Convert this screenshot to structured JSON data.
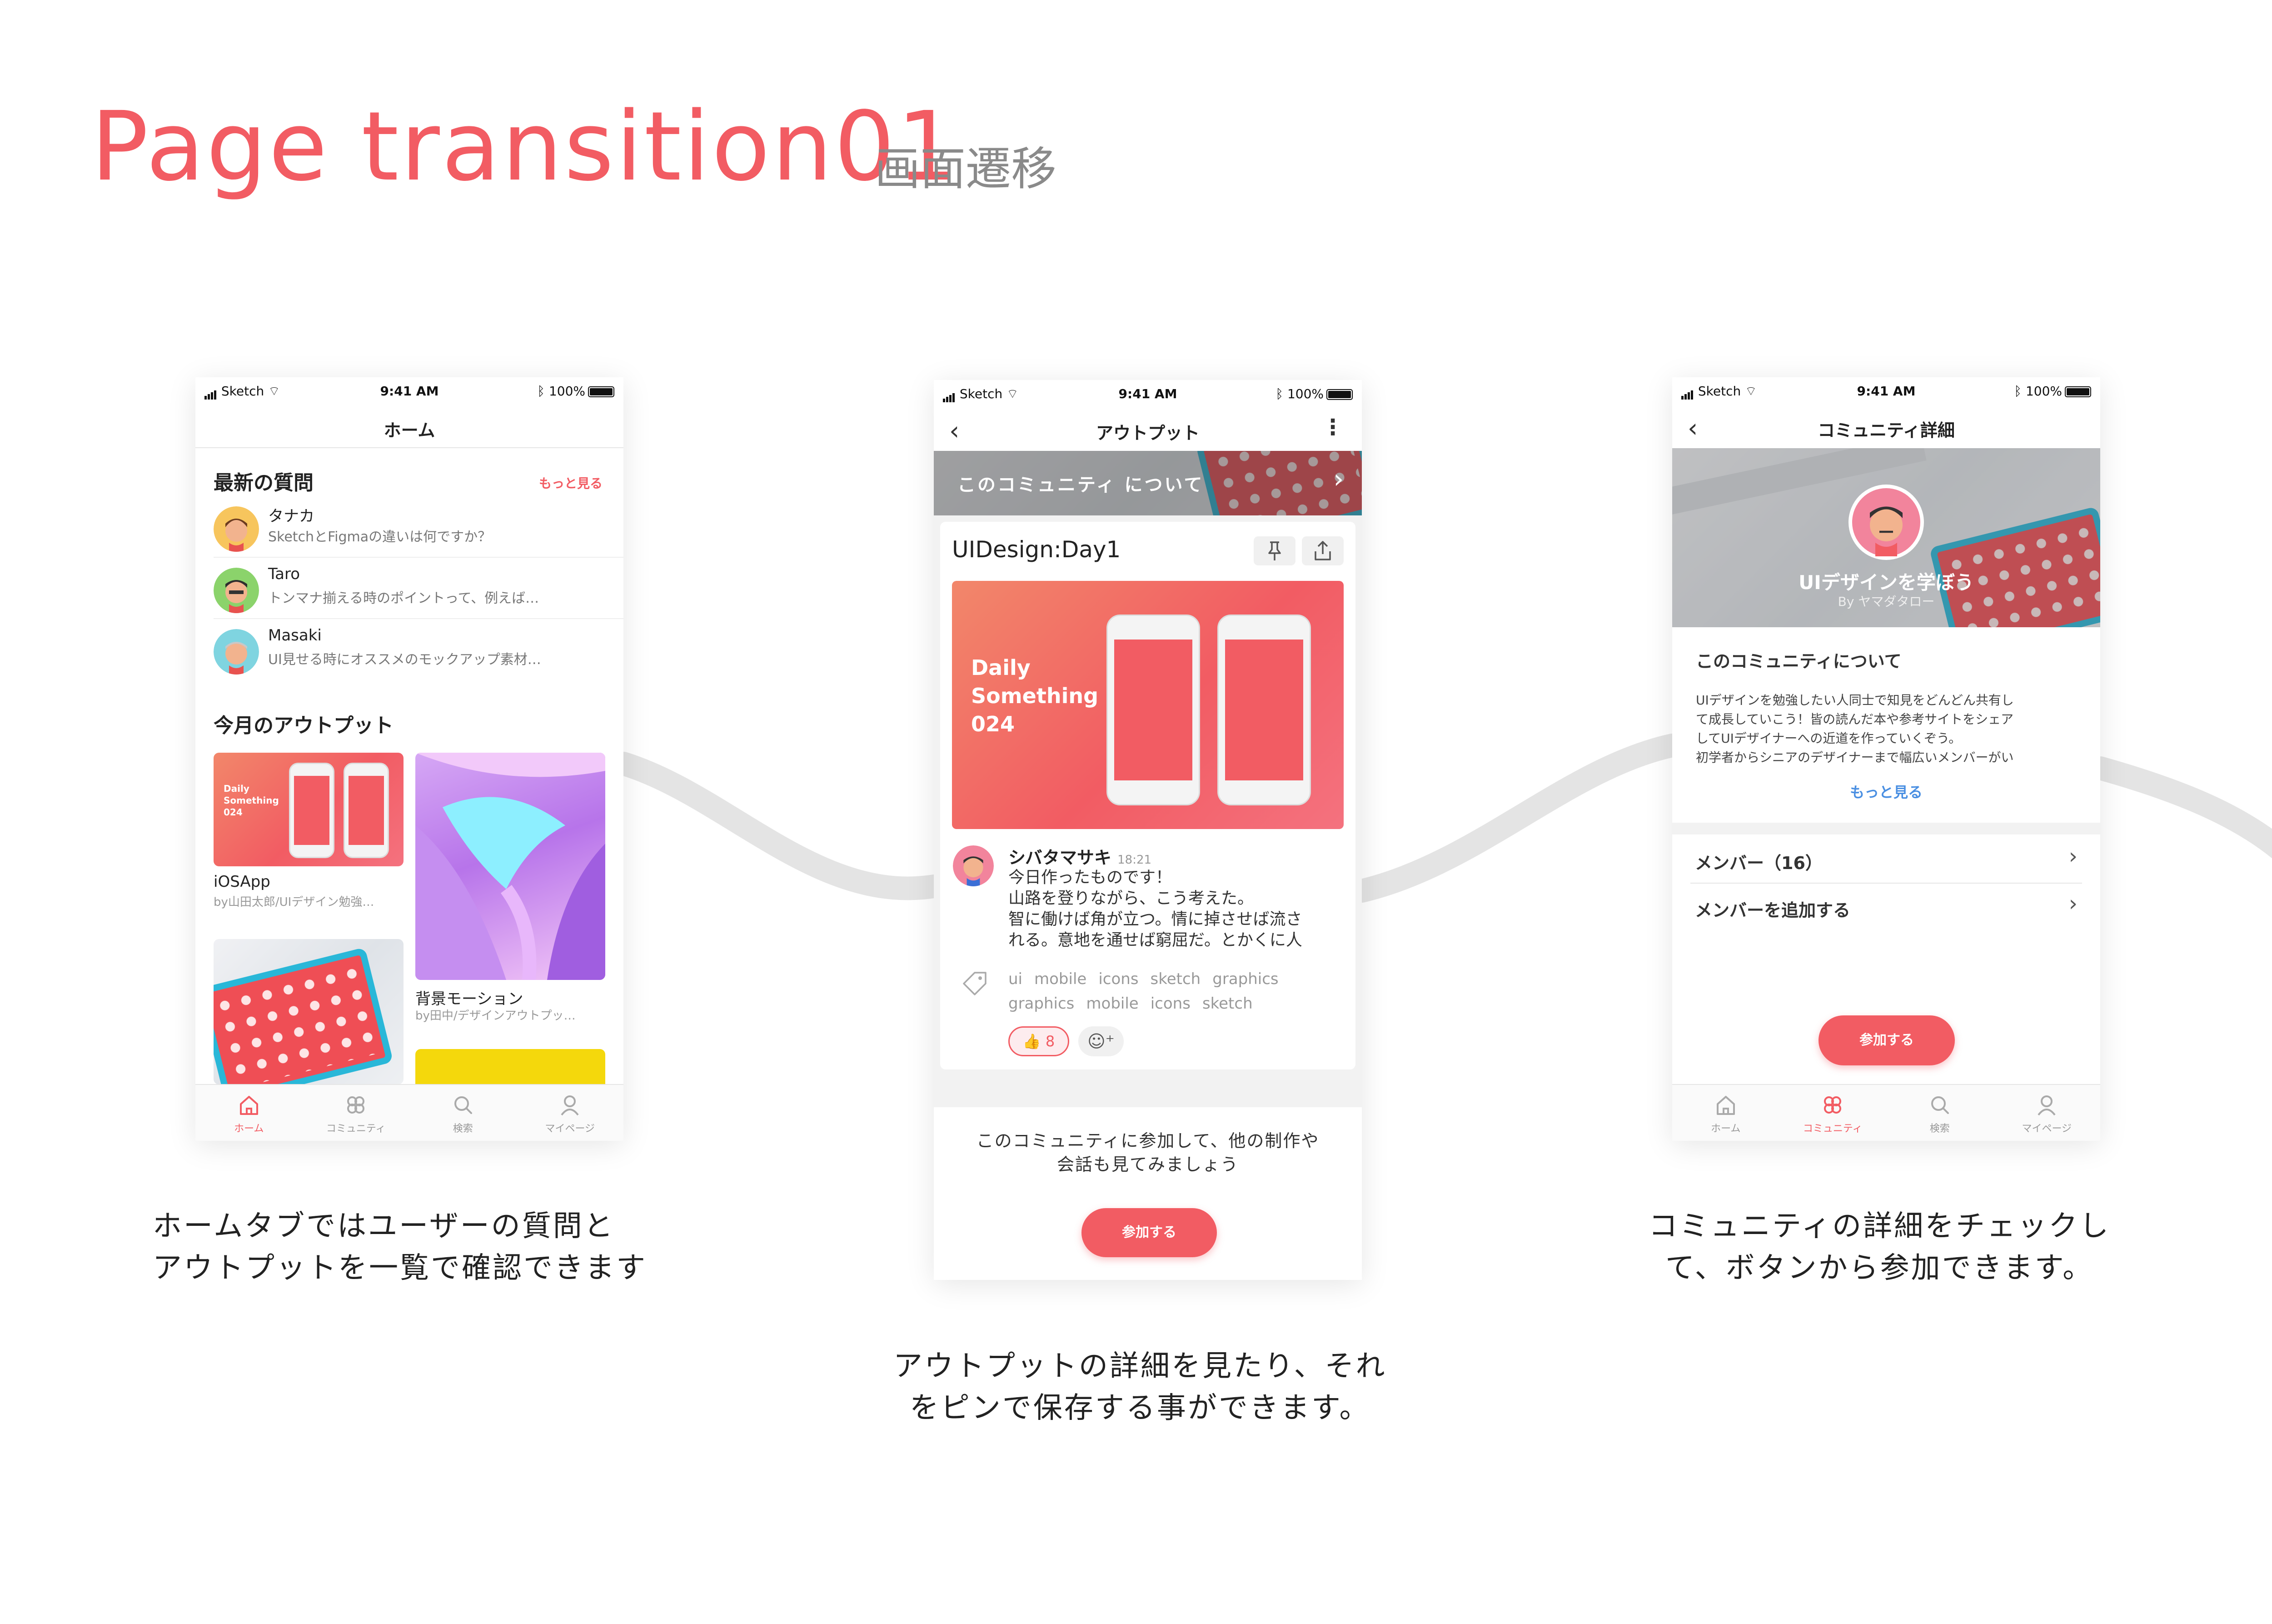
{
  "header": {
    "title": "Page transition01",
    "subtitle": "画面遷移"
  },
  "status_bar": {
    "carrier": "Sketch",
    "time": "9:41 AM",
    "battery": "100%"
  },
  "screen_home": {
    "nav_title": "ホーム",
    "questions_title": "最新の質問",
    "questions_more": "もっと見る",
    "questions": [
      {
        "name": "タナカ",
        "text": "SketchとFigmaの違いは何ですか？"
      },
      {
        "name": "Taro",
        "text": "トンマナ揃える時のポイントって、例えば…"
      },
      {
        "name": "Masaki",
        "text": "UI見せる時にオススメのモックアップ素材…"
      }
    ],
    "outputs_title": "今月のアウトプット",
    "outputs": [
      {
        "title": "iOSApp",
        "sub": "by山田太郎/UIデザイン勉強…",
        "card_text": "Daily Something 024"
      },
      {
        "title": "背景モーション",
        "sub": "by田中/デザインアウトプッ…"
      }
    ],
    "tabs": [
      "ホーム",
      "コミュニティ",
      "検索",
      "マイページ"
    ]
  },
  "screen_output": {
    "nav_title": "アウトプット",
    "banner": "このコミュニティ について",
    "post_title": "UIDesign:Day1",
    "hero_text": "Daily Something 024",
    "author": "シバタマサキ",
    "time": "18:21",
    "body": [
      "今日作ったものです！",
      "山路を登りながら、こう考えた。",
      "智に働けば角が立つ。情に掉させば流さ",
      "れる。意地を通せば窮屈だ。とかくに人"
    ],
    "tags_line1": [
      "ui",
      "mobile",
      "icons",
      "sketch",
      "graphics"
    ],
    "tags_line2": [
      "graphics",
      "mobile",
      "icons",
      "sketch"
    ],
    "like_count": "8",
    "join_text_line1": "このコミュニティに参加して、他の制作や",
    "join_text_line2": "会話も見てみましょう",
    "join_button": "参加する"
  },
  "screen_community": {
    "nav_title": "コミュニティ詳細",
    "community_name": "UIデザインを学ぼう",
    "community_by": "By ヤマダタロー",
    "about_title": "このコミュニティについて",
    "about_lines": [
      "UIデザインを勉強したい人同士で知見をどんどん共有し",
      "て成長していこう！皆の読んだ本や参考サイトをシェア",
      "してUIデザイナーへの近道を作っていくぞう。",
      "初学者からシニアのデザイナーまで幅広いメンバーがい"
    ],
    "about_more": "もっと見る",
    "members": "メンバー（16）",
    "add_member": "メンバーを追加する",
    "join_button": "参加する",
    "tabs": [
      "ホーム",
      "コミュニティ",
      "検索",
      "マイページ"
    ]
  },
  "captions": {
    "home_line1": "ホームタブではユーザーの質問と",
    "home_line2": "アウトプットを一覧で確認できます",
    "output_line1": "アウトプットの詳細を見たり、それ",
    "output_line2": "をピンで保存する事ができます。",
    "community_line1": "コミュニティの詳細をチェックし",
    "community_line2": "て、ボタンから参加できます。"
  },
  "colors": {
    "accent": "#f25c63",
    "link_blue": "#4a8fe2",
    "title_gray": "#8a8a8a"
  }
}
